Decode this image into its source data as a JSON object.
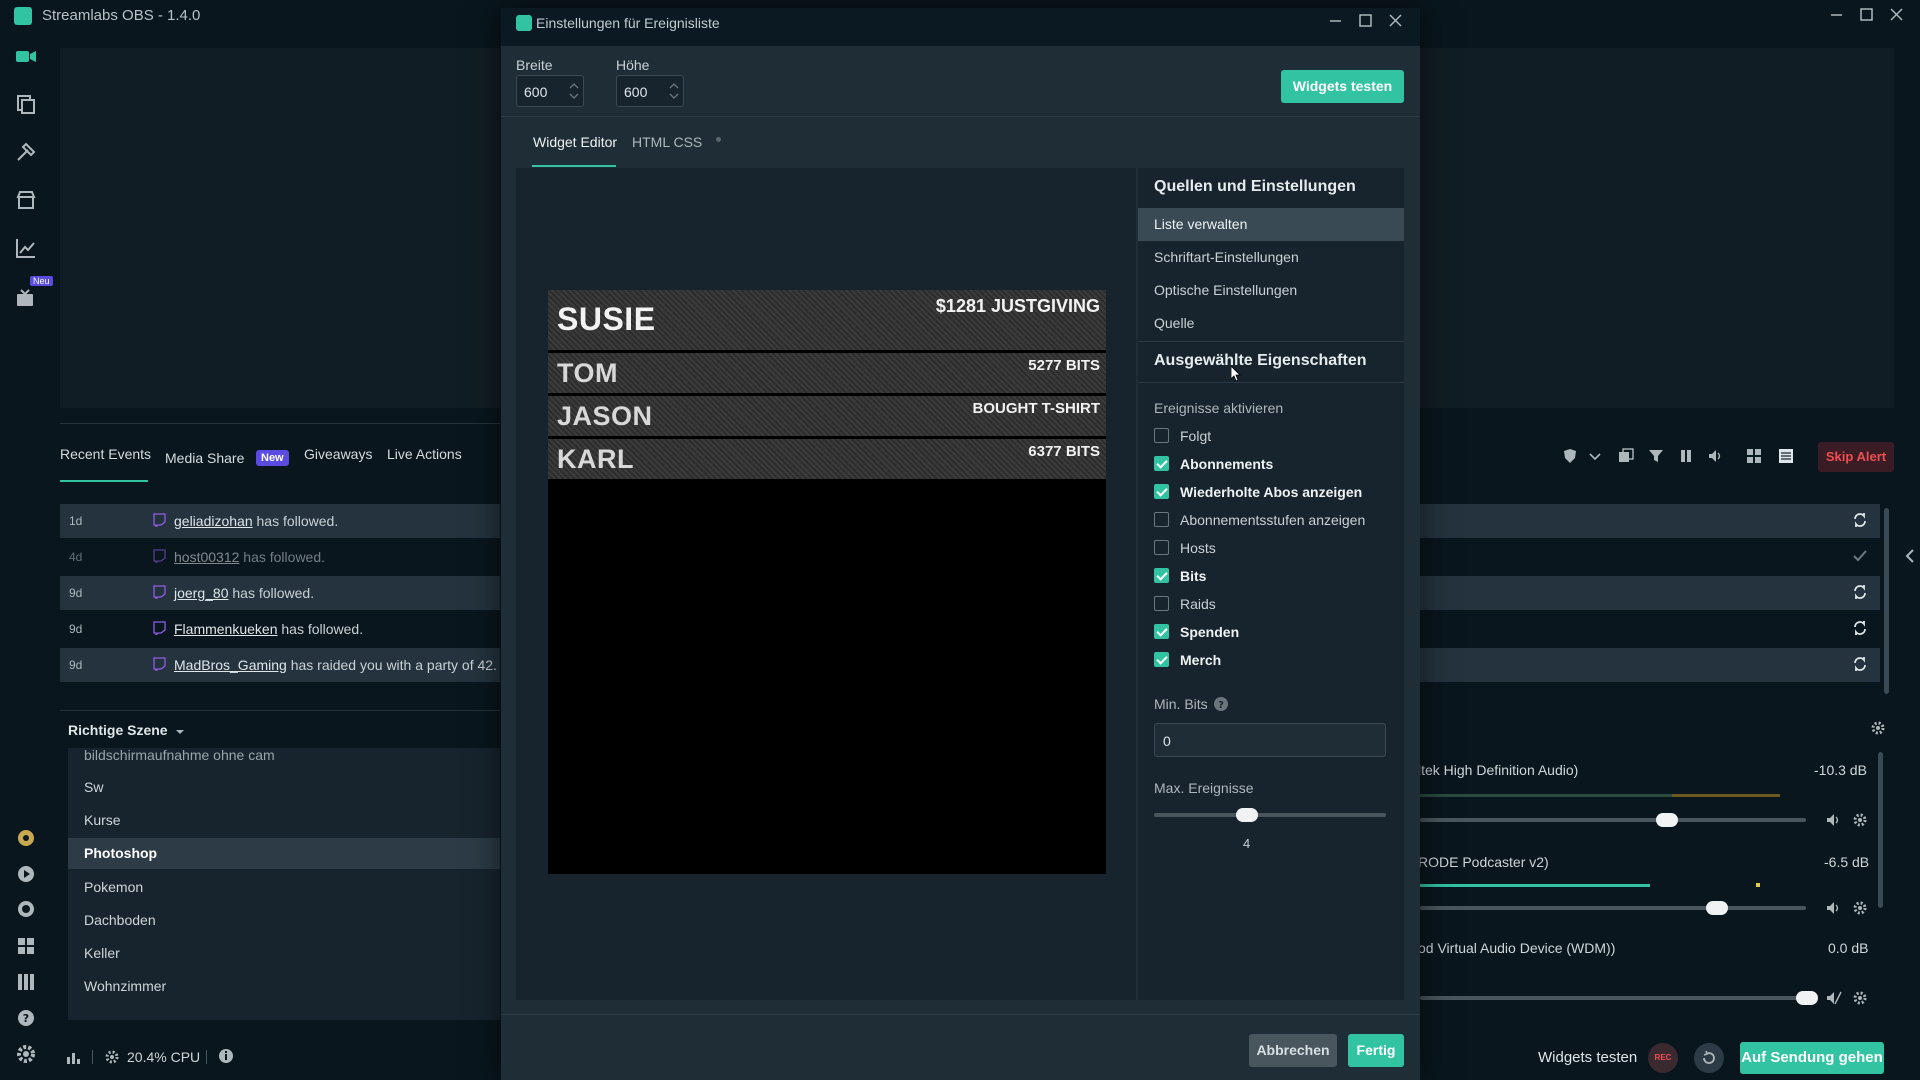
{
  "app": {
    "title": "Streamlabs OBS - 1.4.0"
  },
  "leftnav": {
    "icons": [
      "editor-icon",
      "themes-icon",
      "tools-icon",
      "store-icon",
      "stats-icon",
      "tv-icon"
    ],
    "new_badge": "Neu"
  },
  "events": {
    "tabs": [
      {
        "label": "Recent Events"
      },
      {
        "label": "Media Share",
        "badge": "New"
      },
      {
        "label": "Giveaways"
      },
      {
        "label": "Live Actions"
      }
    ],
    "rows": [
      {
        "time": "1d",
        "user": "geliadizohan",
        "text": " has followed."
      },
      {
        "time": "4d",
        "user": "host00312",
        "text": " has followed."
      },
      {
        "time": "9d",
        "user": "joerg_80",
        "text": " has followed."
      },
      {
        "time": "9d",
        "user": "Flammenkueken",
        "text": " has followed."
      },
      {
        "time": "9d",
        "user": "MadBros_Gaming",
        "text": " has raided you with a party of 42."
      }
    ]
  },
  "scenes": {
    "header": "Richtige Szene",
    "items": [
      "bildschirmaufnahme ohne cam",
      "Sw",
      "Kurse",
      "Photoshop",
      "Pokemon",
      "Dachboden",
      "Keller",
      "Wohnzimmer"
    ],
    "selected": "Photoshop"
  },
  "dialog": {
    "title": "Einstellungen für Ereignisliste",
    "width_label": "Breite",
    "width_value": "600",
    "height_label": "Höhe",
    "height_value": "600",
    "test_button": "Widgets testen",
    "tabs": [
      "Widget Editor",
      "HTML CSS"
    ],
    "preview_events": [
      {
        "name": "SUSIE",
        "value": "$1281 JUSTGIVING"
      },
      {
        "name": "TOM",
        "value": "5277 BITS"
      },
      {
        "name": "JASON",
        "value": "BOUGHT T-SHIRT"
      },
      {
        "name": "KARL",
        "value": "6377 BITS"
      }
    ],
    "side": {
      "section1": "Quellen und Einstellungen",
      "items": [
        "Liste verwalten",
        "Schriftart-Einstellungen",
        "Optische Einstellungen",
        "Quelle"
      ],
      "section2": "Ausgewählte Eigenschaften",
      "events_label": "Ereignisse aktivieren",
      "checkboxes": [
        {
          "label": "Folgt",
          "checked": false
        },
        {
          "label": "Abonnements",
          "checked": true
        },
        {
          "label": "Wiederholte Abos anzeigen",
          "checked": true
        },
        {
          "label": "Abonnementsstufen anzeigen",
          "checked": false
        },
        {
          "label": "Hosts",
          "checked": false
        },
        {
          "label": "Bits",
          "checked": true
        },
        {
          "label": "Raids",
          "checked": false
        },
        {
          "label": "Spenden",
          "checked": true
        },
        {
          "label": "Merch",
          "checked": true
        }
      ],
      "min_bits_label": "Min. Bits",
      "min_bits_value": "0",
      "max_events_label": "Max. Ereignisse",
      "max_events_value": "4",
      "max_events_fraction": 0.4
    },
    "cancel_button": "Abbrechen",
    "done_button": "Fertig"
  },
  "right": {
    "skip_alert": "Skip Alert",
    "mixer": [
      {
        "name": "ltek High Definition Audio)",
        "db": "-10.3 dB",
        "level": 0.74
      },
      {
        "name": "RODE Podcaster v2)",
        "db": "-6.5 dB",
        "level": 0.76
      },
      {
        "name": "od Virtual Audio Device (WDM))",
        "db": "0.0 dB",
        "level": 0.97
      }
    ]
  },
  "bottom": {
    "cpu": "20.4% CPU",
    "test_widgets": "Widgets testen",
    "rec": "REC",
    "go_live": "Auf Sendung gehen"
  },
  "colors": {
    "accent": "#31c3a2",
    "danger": "#f14d53",
    "badge": "#5a4be1"
  }
}
